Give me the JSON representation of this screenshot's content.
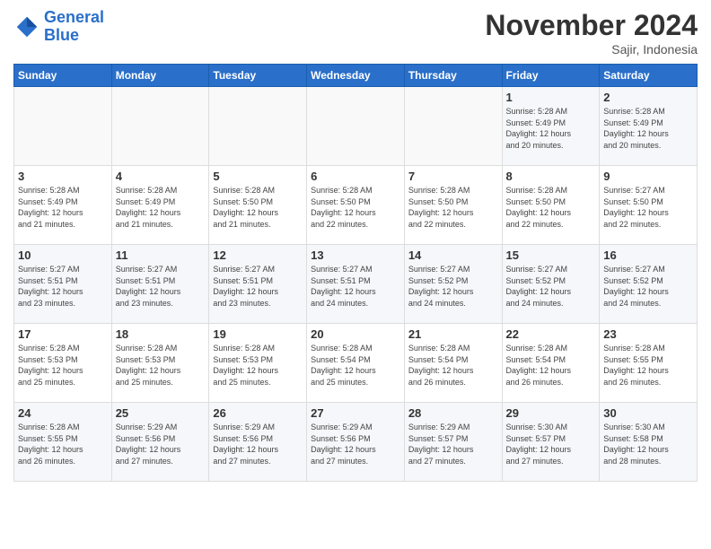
{
  "logo": {
    "line1": "General",
    "line2": "Blue"
  },
  "header": {
    "month": "November 2024",
    "location": "Sajir, Indonesia"
  },
  "weekdays": [
    "Sunday",
    "Monday",
    "Tuesday",
    "Wednesday",
    "Thursday",
    "Friday",
    "Saturday"
  ],
  "weeks": [
    [
      {
        "day": "",
        "info": ""
      },
      {
        "day": "",
        "info": ""
      },
      {
        "day": "",
        "info": ""
      },
      {
        "day": "",
        "info": ""
      },
      {
        "day": "",
        "info": ""
      },
      {
        "day": "1",
        "info": "Sunrise: 5:28 AM\nSunset: 5:49 PM\nDaylight: 12 hours\nand 20 minutes."
      },
      {
        "day": "2",
        "info": "Sunrise: 5:28 AM\nSunset: 5:49 PM\nDaylight: 12 hours\nand 20 minutes."
      }
    ],
    [
      {
        "day": "3",
        "info": "Sunrise: 5:28 AM\nSunset: 5:49 PM\nDaylight: 12 hours\nand 21 minutes."
      },
      {
        "day": "4",
        "info": "Sunrise: 5:28 AM\nSunset: 5:49 PM\nDaylight: 12 hours\nand 21 minutes."
      },
      {
        "day": "5",
        "info": "Sunrise: 5:28 AM\nSunset: 5:50 PM\nDaylight: 12 hours\nand 21 minutes."
      },
      {
        "day": "6",
        "info": "Sunrise: 5:28 AM\nSunset: 5:50 PM\nDaylight: 12 hours\nand 22 minutes."
      },
      {
        "day": "7",
        "info": "Sunrise: 5:28 AM\nSunset: 5:50 PM\nDaylight: 12 hours\nand 22 minutes."
      },
      {
        "day": "8",
        "info": "Sunrise: 5:28 AM\nSunset: 5:50 PM\nDaylight: 12 hours\nand 22 minutes."
      },
      {
        "day": "9",
        "info": "Sunrise: 5:27 AM\nSunset: 5:50 PM\nDaylight: 12 hours\nand 22 minutes."
      }
    ],
    [
      {
        "day": "10",
        "info": "Sunrise: 5:27 AM\nSunset: 5:51 PM\nDaylight: 12 hours\nand 23 minutes."
      },
      {
        "day": "11",
        "info": "Sunrise: 5:27 AM\nSunset: 5:51 PM\nDaylight: 12 hours\nand 23 minutes."
      },
      {
        "day": "12",
        "info": "Sunrise: 5:27 AM\nSunset: 5:51 PM\nDaylight: 12 hours\nand 23 minutes."
      },
      {
        "day": "13",
        "info": "Sunrise: 5:27 AM\nSunset: 5:51 PM\nDaylight: 12 hours\nand 24 minutes."
      },
      {
        "day": "14",
        "info": "Sunrise: 5:27 AM\nSunset: 5:52 PM\nDaylight: 12 hours\nand 24 minutes."
      },
      {
        "day": "15",
        "info": "Sunrise: 5:27 AM\nSunset: 5:52 PM\nDaylight: 12 hours\nand 24 minutes."
      },
      {
        "day": "16",
        "info": "Sunrise: 5:27 AM\nSunset: 5:52 PM\nDaylight: 12 hours\nand 24 minutes."
      }
    ],
    [
      {
        "day": "17",
        "info": "Sunrise: 5:28 AM\nSunset: 5:53 PM\nDaylight: 12 hours\nand 25 minutes."
      },
      {
        "day": "18",
        "info": "Sunrise: 5:28 AM\nSunset: 5:53 PM\nDaylight: 12 hours\nand 25 minutes."
      },
      {
        "day": "19",
        "info": "Sunrise: 5:28 AM\nSunset: 5:53 PM\nDaylight: 12 hours\nand 25 minutes."
      },
      {
        "day": "20",
        "info": "Sunrise: 5:28 AM\nSunset: 5:54 PM\nDaylight: 12 hours\nand 25 minutes."
      },
      {
        "day": "21",
        "info": "Sunrise: 5:28 AM\nSunset: 5:54 PM\nDaylight: 12 hours\nand 26 minutes."
      },
      {
        "day": "22",
        "info": "Sunrise: 5:28 AM\nSunset: 5:54 PM\nDaylight: 12 hours\nand 26 minutes."
      },
      {
        "day": "23",
        "info": "Sunrise: 5:28 AM\nSunset: 5:55 PM\nDaylight: 12 hours\nand 26 minutes."
      }
    ],
    [
      {
        "day": "24",
        "info": "Sunrise: 5:28 AM\nSunset: 5:55 PM\nDaylight: 12 hours\nand 26 minutes."
      },
      {
        "day": "25",
        "info": "Sunrise: 5:29 AM\nSunset: 5:56 PM\nDaylight: 12 hours\nand 27 minutes."
      },
      {
        "day": "26",
        "info": "Sunrise: 5:29 AM\nSunset: 5:56 PM\nDaylight: 12 hours\nand 27 minutes."
      },
      {
        "day": "27",
        "info": "Sunrise: 5:29 AM\nSunset: 5:56 PM\nDaylight: 12 hours\nand 27 minutes."
      },
      {
        "day": "28",
        "info": "Sunrise: 5:29 AM\nSunset: 5:57 PM\nDaylight: 12 hours\nand 27 minutes."
      },
      {
        "day": "29",
        "info": "Sunrise: 5:30 AM\nSunset: 5:57 PM\nDaylight: 12 hours\nand 27 minutes."
      },
      {
        "day": "30",
        "info": "Sunrise: 5:30 AM\nSunset: 5:58 PM\nDaylight: 12 hours\nand 28 minutes."
      }
    ]
  ]
}
